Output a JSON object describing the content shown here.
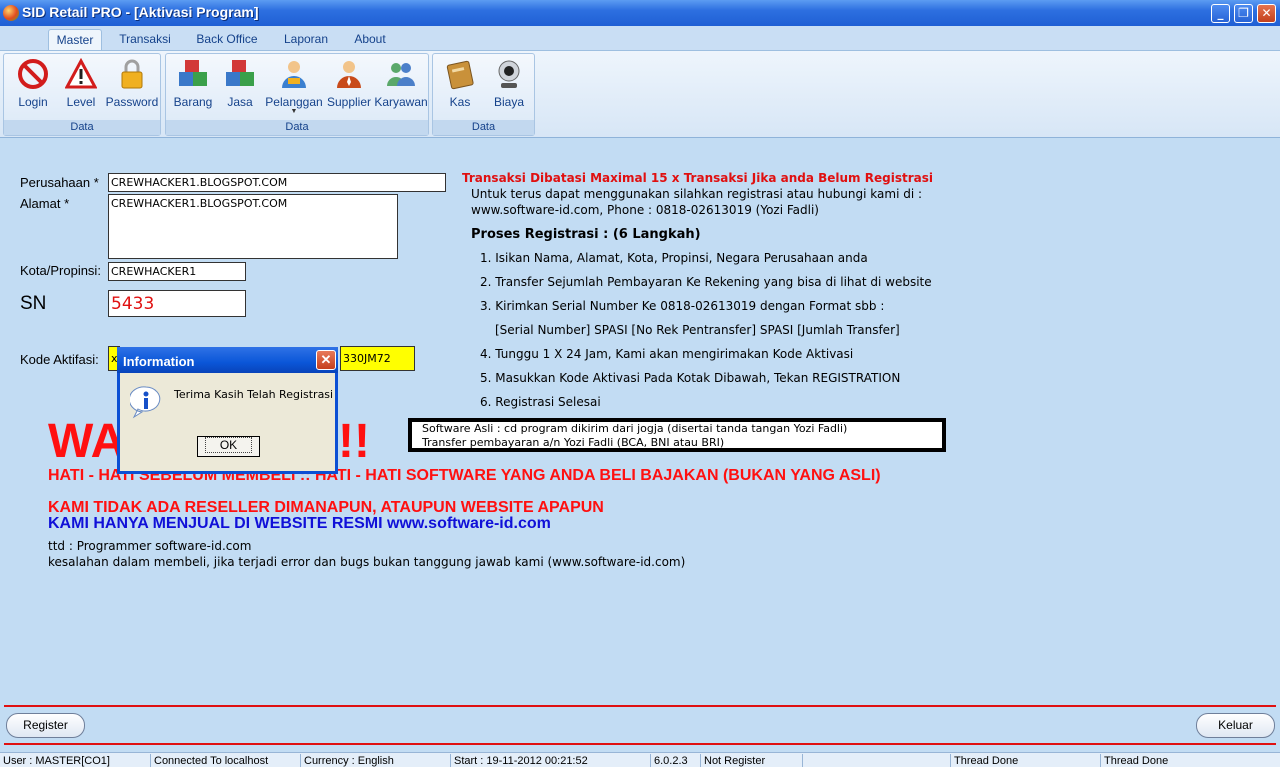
{
  "window": {
    "title": "SID Retail PRO - [Aktivasi Program]"
  },
  "ribbon": {
    "tabs": [
      "Master",
      "Transaksi",
      "Back Office",
      "Laporan",
      "About"
    ],
    "groups": [
      {
        "label": "Data",
        "buttons": [
          "Login",
          "Level",
          "Password"
        ]
      },
      {
        "label": "Data",
        "buttons": [
          "Barang",
          "Jasa",
          "Pelanggan",
          "Supplier",
          "Karyawan"
        ]
      },
      {
        "label": "Data",
        "buttons": [
          "Kas",
          "Biaya"
        ]
      }
    ]
  },
  "form": {
    "perusahaan_label": "Perusahaan *",
    "perusahaan_value": "CREWHACKER1.BLOGSPOT.COM",
    "alamat_label": "Alamat *",
    "alamat_value": "CREWHACKER1.BLOGSPOT.COM",
    "kota_label": "Kota/Propinsi:",
    "kota_value": "CREWHACKER1",
    "sn_label": "SN",
    "sn_value": "5433",
    "kode_label": "Kode Aktifasi:",
    "kode_value_left": "x",
    "kode_value_right": "330JM72"
  },
  "info": {
    "heading": "Transaksi Dibatasi Maximal 15 x Transaksi Jika anda Belum Registrasi",
    "line1": "Untuk terus dapat menggunakan silahkan registrasi atau hubungi kami di :",
    "line2": "www.software-id.com, Phone : 0818-02613019 (Yozi Fadli)",
    "proses": "Proses Registrasi : (6 Langkah)",
    "steps": [
      "1. Isikan Nama, Alamat, Kota, Propinsi, Negara Perusahaan anda",
      "2. Transfer Sejumlah Pembayaran Ke Rekening yang bisa di lihat di website",
      "3. Kirimkan Serial Number Ke 0818-02613019 dengan Format sbb :",
      "[Serial Number] SPASI [No Rek Pentransfer] SPASI [Jumlah Transfer]",
      "4. Tunggu 1 X 24 Jam, Kami akan mengirimakan Kode Aktivasi",
      "5. Masukkan Kode Aktivasi Pada Kotak Dibawah, Tekan REGISTRATION",
      "6. Registrasi Selesai"
    ],
    "box_line1": "Software Asli : cd program dikirim dari jogja (disertai tanda tangan Yozi Fadli)",
    "box_line2": "Transfer pembayaran a/n Yozi Fadli (BCA, BNI atau BRI)"
  },
  "warning": {
    "big_left": "WA",
    "big_right": "!!",
    "line1": "HATI - HATI SEBELUM MEMBELI :: HATI - HATI SOFTWARE YANG ANDA BELI BAJAKAN (BUKAN YANG ASLI)",
    "line2": "KAMI TIDAK ADA RESELLER DIMANAPUN, ATAUPUN WEBSITE APAPUN",
    "line3": "KAMI HANYA MENJUAL DI WEBSITE RESMI www.software-id.com",
    "ttd": "ttd : Programmer software-id.com",
    "note": "kesalahan dalam membeli, jika terjadi error dan bugs bukan tanggung jawab kami (www.software-id.com)"
  },
  "dialog": {
    "title": "Information",
    "message": "Terima Kasih Telah Registrasi",
    "ok": "OK"
  },
  "buttons": {
    "register": "Register",
    "keluar": "Keluar"
  },
  "statusbar": [
    "User : MASTER[CO1]",
    "Connected To localhost",
    "Currency : English",
    "Start  : 19-11-2012 00:21:52",
    "6.0.2.3",
    "Not Register",
    "",
    "Thread Done",
    "Thread Done"
  ]
}
